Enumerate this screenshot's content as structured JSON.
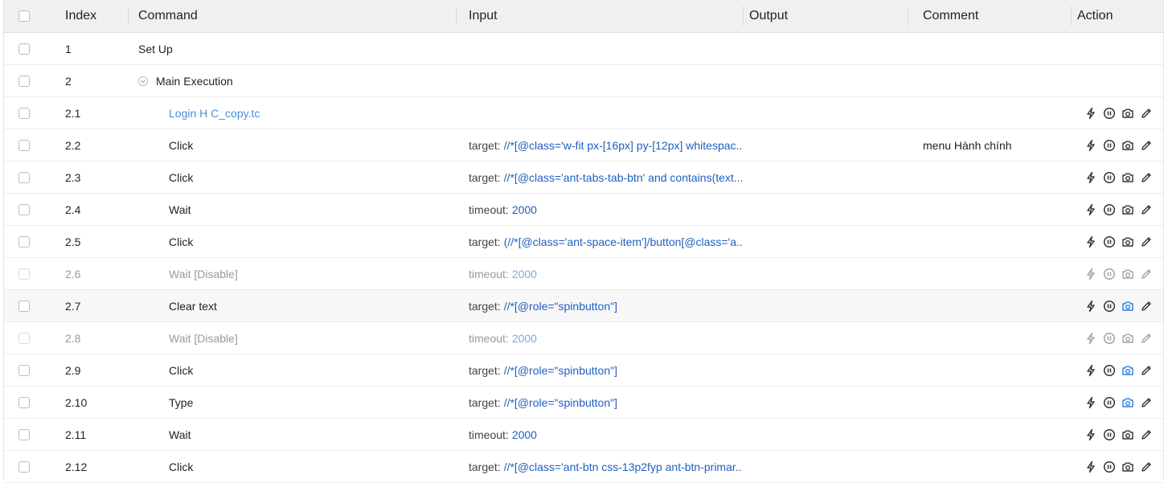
{
  "header": {
    "index": "Index",
    "command": "Command",
    "input": "Input",
    "output": "Output",
    "comment": "Comment",
    "action": "Action"
  },
  "colors": {
    "link": "#4a8fd6",
    "value": "#1f5fbf",
    "camera_active": "#2f7de1"
  },
  "rows": [
    {
      "index": "1",
      "command": "Set Up",
      "kind": "group",
      "disabled": false,
      "highlight": false,
      "input_label": "",
      "input_value": "",
      "comment": "",
      "actions": false,
      "camera_active": false,
      "expander": false
    },
    {
      "index": "2",
      "command": "Main Execution",
      "kind": "group",
      "disabled": false,
      "highlight": false,
      "input_label": "",
      "input_value": "",
      "comment": "",
      "actions": false,
      "camera_active": false,
      "expander": true
    },
    {
      "index": "2.1",
      "command": "Login H C_copy.tc",
      "kind": "link",
      "disabled": false,
      "highlight": false,
      "input_label": "",
      "input_value": "",
      "comment": "",
      "actions": true,
      "camera_active": false,
      "expander": false
    },
    {
      "index": "2.2",
      "command": "Click",
      "kind": "step",
      "disabled": false,
      "highlight": false,
      "input_label": "target:",
      "input_value": "//*[@class='w-fit px-[16px] py-[12px] whitespac...",
      "comment": "menu Hành chính",
      "actions": true,
      "camera_active": false,
      "expander": false
    },
    {
      "index": "2.3",
      "command": "Click",
      "kind": "step",
      "disabled": false,
      "highlight": false,
      "input_label": "target:",
      "input_value": "//*[@class='ant-tabs-tab-btn' and contains(text...",
      "comment": "",
      "actions": true,
      "camera_active": false,
      "expander": false
    },
    {
      "index": "2.4",
      "command": "Wait",
      "kind": "step",
      "disabled": false,
      "highlight": false,
      "input_label": "timeout:",
      "input_value": "2000",
      "comment": "",
      "actions": true,
      "camera_active": false,
      "expander": false
    },
    {
      "index": "2.5",
      "command": "Click",
      "kind": "step",
      "disabled": false,
      "highlight": false,
      "input_label": "target:",
      "input_value": "(//*[@class='ant-space-item']/button[@class='a...",
      "comment": "",
      "actions": true,
      "camera_active": false,
      "expander": false
    },
    {
      "index": "2.6",
      "command": "Wait [Disable]",
      "kind": "step",
      "disabled": true,
      "highlight": false,
      "input_label": "timeout:",
      "input_value": "2000",
      "comment": "",
      "actions": true,
      "camera_active": false,
      "expander": false
    },
    {
      "index": "2.7",
      "command": "Clear text",
      "kind": "step",
      "disabled": false,
      "highlight": true,
      "input_label": "target:",
      "input_value": "//*[@role=\"spinbutton\"]",
      "comment": "",
      "actions": true,
      "camera_active": true,
      "expander": false
    },
    {
      "index": "2.8",
      "command": "Wait [Disable]",
      "kind": "step",
      "disabled": true,
      "highlight": false,
      "input_label": "timeout:",
      "input_value": "2000",
      "comment": "",
      "actions": true,
      "camera_active": false,
      "expander": false
    },
    {
      "index": "2.9",
      "command": "Click",
      "kind": "step",
      "disabled": false,
      "highlight": false,
      "input_label": "target:",
      "input_value": "//*[@role=\"spinbutton\"]",
      "comment": "",
      "actions": true,
      "camera_active": true,
      "expander": false
    },
    {
      "index": "2.10",
      "command": "Type",
      "kind": "step",
      "disabled": false,
      "highlight": false,
      "input_label": "target:",
      "input_value": "//*[@role=\"spinbutton\"]",
      "comment": "",
      "actions": true,
      "camera_active": true,
      "expander": false
    },
    {
      "index": "2.11",
      "command": "Wait",
      "kind": "step",
      "disabled": false,
      "highlight": false,
      "input_label": "timeout:",
      "input_value": "2000",
      "comment": "",
      "actions": true,
      "camera_active": false,
      "expander": false
    },
    {
      "index": "2.12",
      "command": "Click",
      "kind": "step",
      "disabled": false,
      "highlight": false,
      "input_label": "target:",
      "input_value": "//*[@class='ant-btn css-13p2fyp ant-btn-primar...",
      "comment": "",
      "actions": true,
      "camera_active": false,
      "expander": false
    }
  ]
}
